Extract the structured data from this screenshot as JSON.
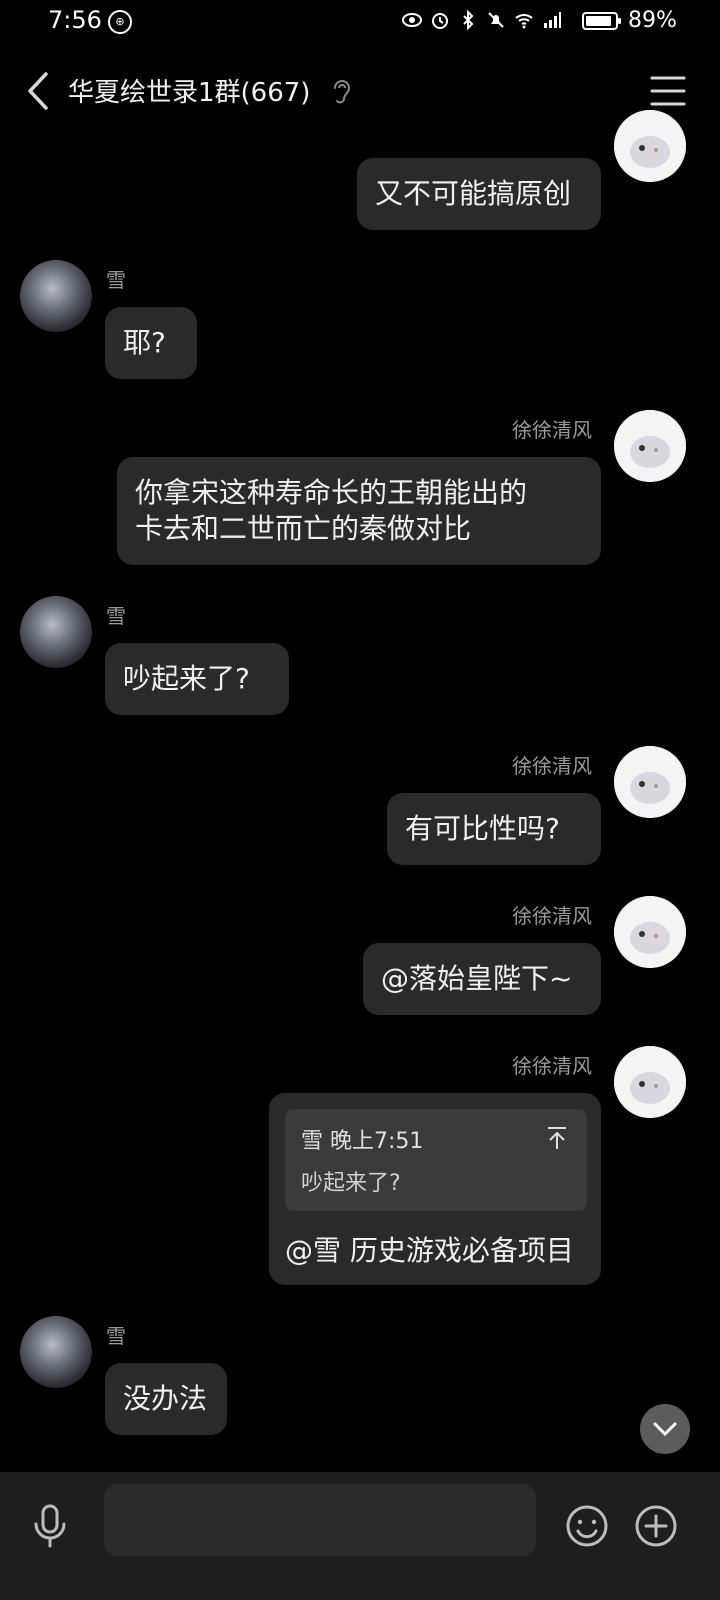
{
  "status": {
    "time": "7:56",
    "battery": "89%",
    "battery_level": 0.89,
    "icons": [
      "eye-icon",
      "alarm-icon",
      "bluetooth-icon",
      "mute-icon",
      "wifi-icon",
      "signal-icon"
    ]
  },
  "header": {
    "title": "华夏绘世录1群(667)",
    "icons": [
      "back-icon",
      "ear-icon",
      "menu-icon"
    ]
  },
  "messages": [
    {
      "sender": "",
      "text": "又不可能搞原创",
      "side": "right"
    },
    {
      "sender": "雪",
      "text": "耶?",
      "side": "left"
    },
    {
      "sender": "徐徐清风",
      "text": "你拿宋这种寿命长的王朝能出的\n卡去和二世而亡的秦做对比",
      "side": "right"
    },
    {
      "sender": "雪",
      "text": "吵起来了?",
      "side": "left"
    },
    {
      "sender": "徐徐清风",
      "text": "有可比性吗?",
      "side": "right"
    },
    {
      "sender": "徐徐清风",
      "text": "@落始皇陛下~",
      "side": "right"
    },
    {
      "sender": "徐徐清风",
      "side": "right",
      "reply": {
        "author": "雪",
        "time": "晚上7:51",
        "quote": "吵起来了?"
      },
      "text": "@雪 历史游戏必备项目"
    },
    {
      "sender": "雪",
      "text": "没办法",
      "side": "left"
    }
  ],
  "input": {
    "placeholder": ""
  },
  "colors": {
    "background": "#000000",
    "bubble": "#2a2a2a",
    "sender": "#9a9a9a",
    "input_bar": "#1e1e1e"
  }
}
